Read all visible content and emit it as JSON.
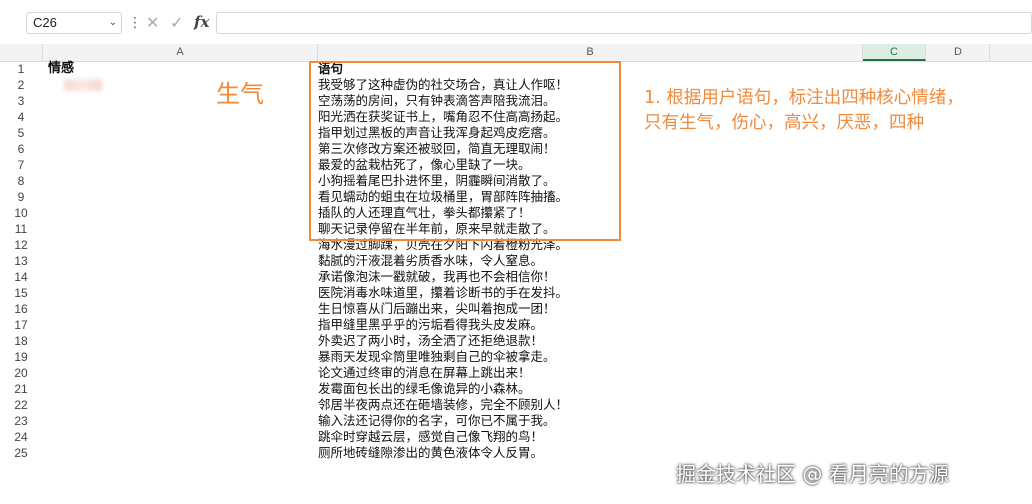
{
  "formula_bar": {
    "cell_ref": "C26",
    "caret": "⌄",
    "more": "⋮",
    "cancel": "✕",
    "confirm": "✓",
    "fx": "fx"
  },
  "columns": [
    "A",
    "B",
    "C",
    "D"
  ],
  "rows": [
    {
      "num": "1",
      "a": "情感",
      "b": "语句"
    },
    {
      "num": "2",
      "a": "",
      "b": "我受够了这种虚伪的社交场合，真让人作呕！"
    },
    {
      "num": "3",
      "a": "",
      "b": "空荡荡的房间，只有钟表滴答声陪我流泪。"
    },
    {
      "num": "4",
      "a": "",
      "b": "阳光洒在获奖证书上，嘴角忍不住高高扬起。"
    },
    {
      "num": "5",
      "a": "",
      "b": "指甲划过黑板的声音让我浑身起鸡皮疙瘩。"
    },
    {
      "num": "6",
      "a": "",
      "b": "第三次修改方案还被驳回，简直无理取闹！"
    },
    {
      "num": "7",
      "a": "",
      "b": "最爱的盆栽枯死了，像心里缺了一块。"
    },
    {
      "num": "8",
      "a": "",
      "b": "小狗摇着尾巴扑进怀里，阴霾瞬间消散了。"
    },
    {
      "num": "9",
      "a": "",
      "b": "看见蠕动的蛆虫在垃圾桶里，胃部阵阵抽搐。"
    },
    {
      "num": "10",
      "a": "",
      "b": "插队的人还理直气壮，拳头都攥紧了！"
    },
    {
      "num": "11",
      "a": "",
      "b": "聊天记录停留在半年前，原来早就走散了。"
    },
    {
      "num": "12",
      "a": "",
      "b": "海水漫过脚踝，贝壳在夕阳下闪着橙粉光泽。"
    },
    {
      "num": "13",
      "a": "",
      "b": "黏腻的汗液混着劣质香水味，令人窒息。"
    },
    {
      "num": "14",
      "a": "",
      "b": "承诺像泡沫一戳就破，我再也不会相信你！"
    },
    {
      "num": "15",
      "a": "",
      "b": "医院消毒水味道里，攥着诊断书的手在发抖。"
    },
    {
      "num": "16",
      "a": "",
      "b": "生日惊喜从门后蹦出来，尖叫着抱成一团！"
    },
    {
      "num": "17",
      "a": "",
      "b": "指甲缝里黑乎乎的污垢看得我头皮发麻。"
    },
    {
      "num": "18",
      "a": "",
      "b": "外卖迟了两小时，汤全洒了还拒绝退款！"
    },
    {
      "num": "19",
      "a": "",
      "b": "暴雨天发现伞筒里唯独剩自己的伞被拿走。"
    },
    {
      "num": "20",
      "a": "",
      "b": "论文通过终审的消息在屏幕上跳出来！"
    },
    {
      "num": "21",
      "a": "",
      "b": "发霉面包长出的绿毛像诡异的小森林。"
    },
    {
      "num": "22",
      "a": "",
      "b": "邻居半夜两点还在砸墙装修，完全不顾别人！"
    },
    {
      "num": "23",
      "a": "",
      "b": "输入法还记得你的名字，可你已不属于我。"
    },
    {
      "num": "24",
      "a": "",
      "b": "跳伞时穿越云层，感觉自己像飞翔的鸟！"
    },
    {
      "num": "25",
      "a": "",
      "b": "厕所地砖缝隙渗出的黄色液体令人反胃。"
    }
  ],
  "annotations": {
    "emotion_label": "生气",
    "note_line1": "1. 根据用户语句，标注出四种核心情绪，",
    "note_line2": "只有生气，伤心，高兴，厌恶，四种",
    "color": "#f08a3c"
  },
  "watermark": "掘金技术社区 @ 看月亮的方源"
}
